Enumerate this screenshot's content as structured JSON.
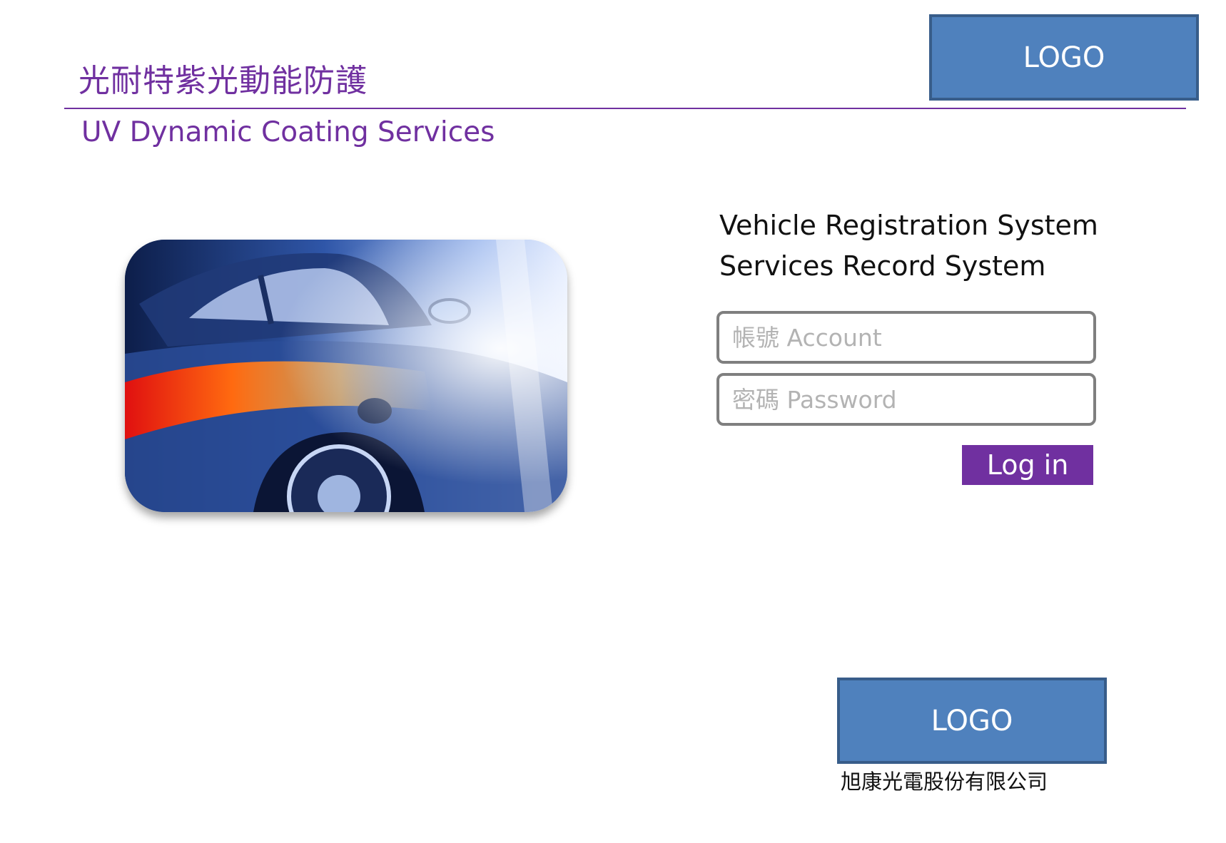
{
  "header": {
    "title_cn": "光耐特紫光動能防護",
    "title_en": "UV Dynamic Coating Services",
    "logo_top": "LOGO",
    "accent_color": "#7030a0"
  },
  "hero": {
    "image_icon": "car-photo"
  },
  "login": {
    "system_line1": "Vehicle Registration System",
    "system_line2": "Services Record System",
    "account_placeholder": "帳號 Account",
    "password_placeholder": "密碼 Password",
    "login_label": "Log in",
    "button_color": "#7030a0"
  },
  "footer": {
    "logo_bottom": "LOGO",
    "company_name": "旭康光電股份有限公司",
    "logo_color": "#4f81bd"
  }
}
